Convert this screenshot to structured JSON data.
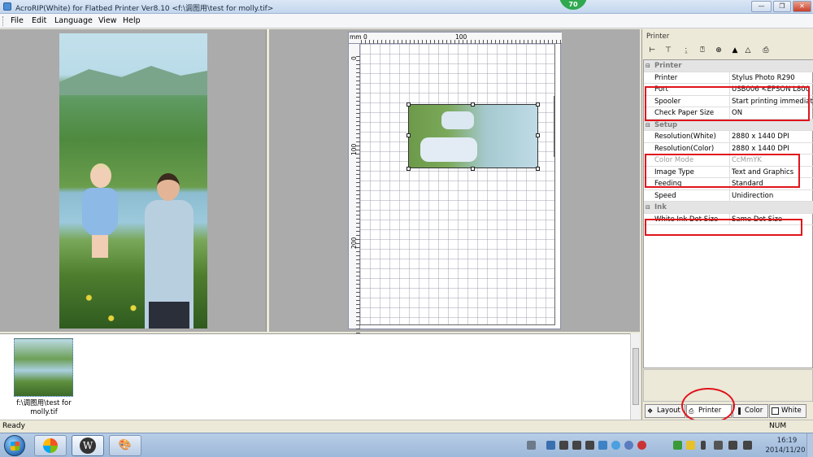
{
  "window": {
    "title": "AcroRIP(White) for Flatbed Printer Ver8.10  <f:\\调图用\\test for molly.tif>",
    "badge": "70",
    "min_icon": "minimize-icon",
    "max_icon": "maximize-icon",
    "close_icon": "close-icon"
  },
  "menu": [
    "File",
    "Edit",
    "Language",
    "View",
    "Help"
  ],
  "ruler": {
    "unit": "mm",
    "top_labels": [
      "0",
      "100"
    ],
    "left_labels": [
      "0",
      "100",
      "200"
    ]
  },
  "panel": {
    "title": "Printer",
    "toolbar_icons": [
      "align-left-icon",
      "align-top-icon",
      "center-horizontal-icon",
      "center-vertical-icon",
      "center-icon",
      "flip-horizontal-icon",
      "mirror-icon",
      "print-icon"
    ],
    "rows": [
      {
        "type": "category",
        "key": "Printer"
      },
      {
        "key": "Printer",
        "value": "Stylus Photo R290"
      },
      {
        "key": "Port",
        "value": "USB006   <EPSON L800"
      },
      {
        "key": "Spooler",
        "value": "Start printing immediately"
      },
      {
        "key": "Check Paper Size",
        "value": "ON"
      },
      {
        "type": "category",
        "key": "Setup"
      },
      {
        "key": "Resolution(White)",
        "value": "2880 x 1440 DPI"
      },
      {
        "key": "Resolution(Color)",
        "value": "2880 x 1440 DPI"
      },
      {
        "key": "Color Mode",
        "value": "CcMmYK",
        "dim": true
      },
      {
        "key": "Image Type",
        "value": "Text and Graphics"
      },
      {
        "key": "Feeding",
        "value": "Standard"
      },
      {
        "key": "Speed",
        "value": "Unidirection"
      },
      {
        "type": "category",
        "key": "Ink"
      },
      {
        "key": "White Ink Dot Size",
        "value": "Same Dot Size"
      }
    ],
    "tabs": [
      {
        "label": "Layout",
        "icon": "layout-icon"
      },
      {
        "label": "Printer",
        "icon": "printer-icon"
      },
      {
        "label": "Color",
        "icon": "color-icon"
      },
      {
        "label": "White",
        "icon": "white-icon"
      }
    ]
  },
  "thumbnail": {
    "label_line1": "f:\\调图用\\test for",
    "label_line2": "molly.tif"
  },
  "status": {
    "left": "Ready",
    "right": "NUM"
  },
  "taskbar": {
    "apps": [
      "windows-start",
      "media-player-icon",
      "wordpress-icon",
      "paint-icon"
    ],
    "time": "16:19",
    "date": "2014/11/20"
  },
  "colors": {
    "annotation_red": "#e0141b",
    "title_gradient_top": "#dbe7f5"
  }
}
